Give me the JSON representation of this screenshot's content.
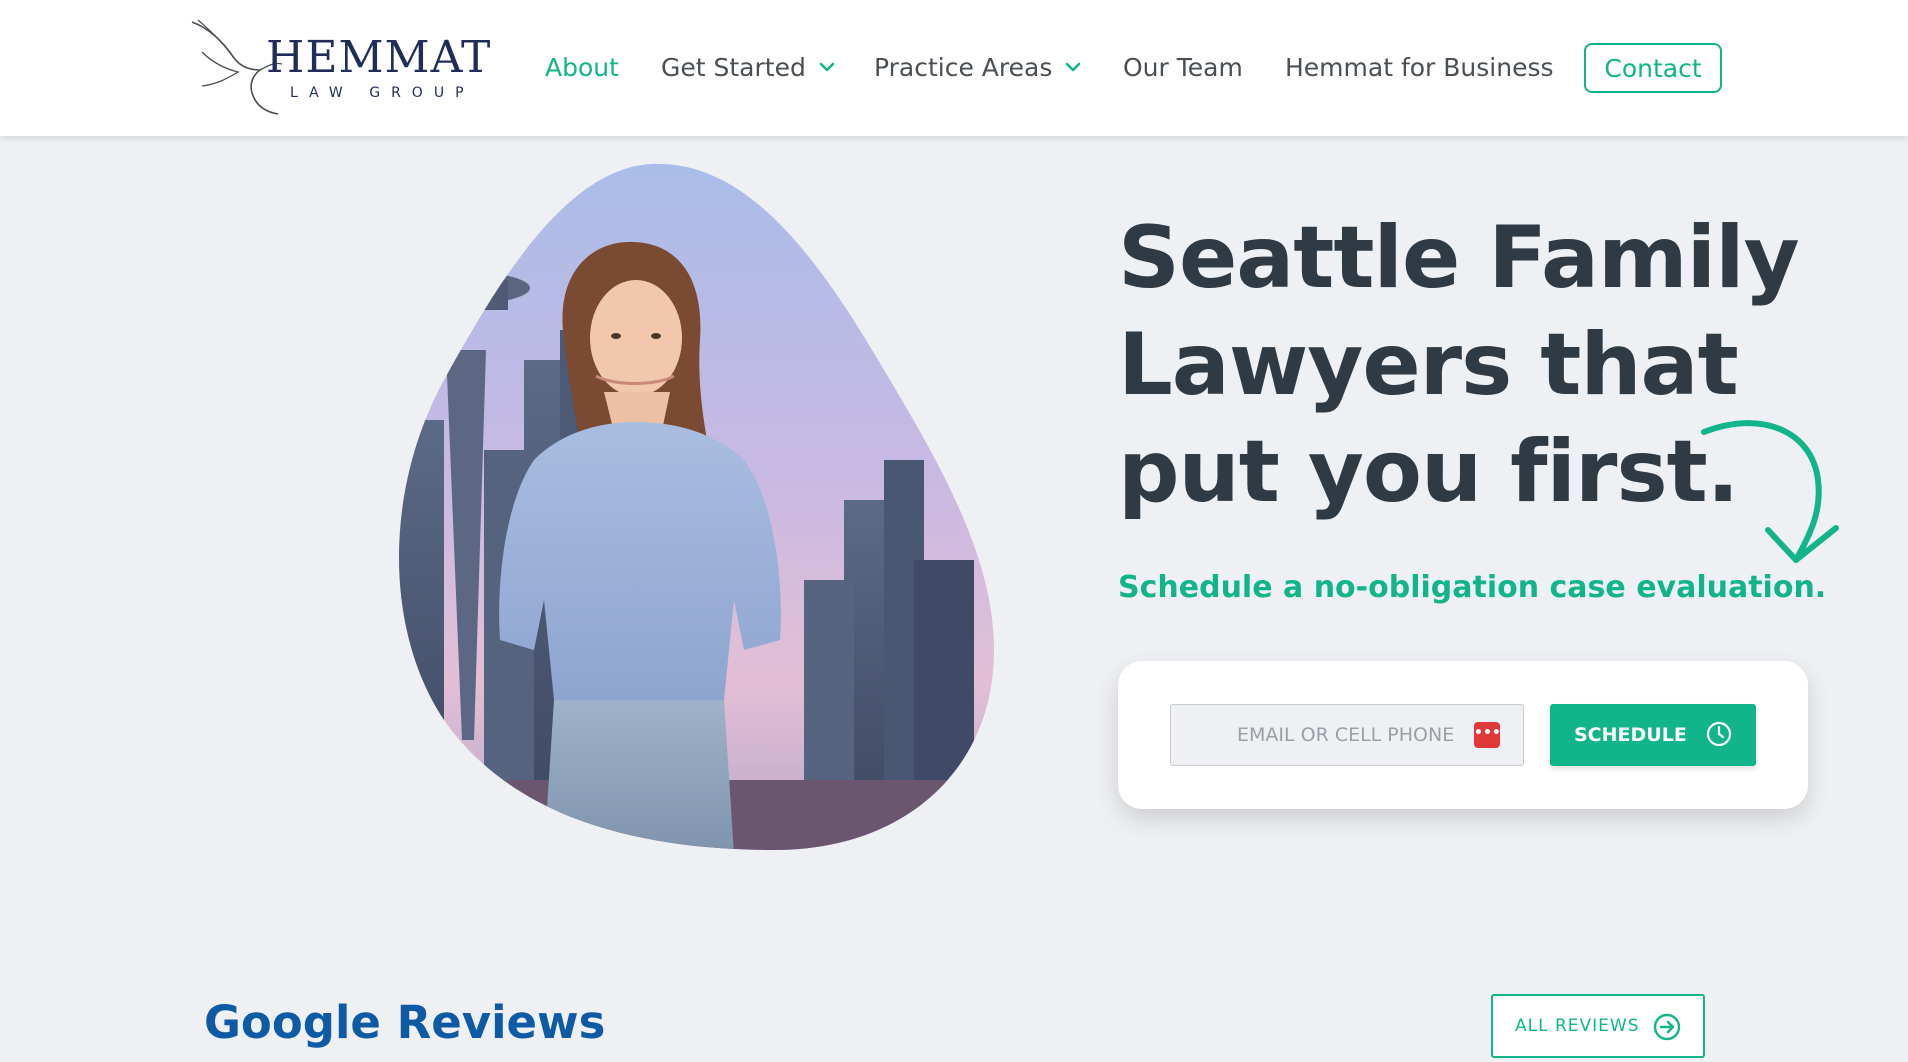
{
  "header": {
    "logo": {
      "word": "HEMMAT",
      "sub": "LAW GROUP"
    },
    "nav": [
      {
        "label": "About",
        "active": true
      },
      {
        "label": "Get Started",
        "dropdown": true
      },
      {
        "label": "Practice Areas",
        "dropdown": true
      },
      {
        "label": "Our Team"
      },
      {
        "label": "Hemmat for Business"
      }
    ],
    "contact_label": "Contact"
  },
  "hero": {
    "title": "Seattle Family Lawyers that put you first.",
    "subtitle": "Schedule a no-obligation case evaluation.",
    "form": {
      "placeholder": "EMAIL OR CELL PHONE",
      "badge": "•••",
      "button_label": "SCHEDULE"
    }
  },
  "reviews": {
    "title": "Google Reviews",
    "all_label": "ALL REVIEWS"
  },
  "colors": {
    "accent": "#12b48a",
    "heading": "#2f3a45",
    "brand_blue": "#0f5aa4",
    "logo_navy": "#1f2d58",
    "page_bg": "#eef0f3"
  }
}
